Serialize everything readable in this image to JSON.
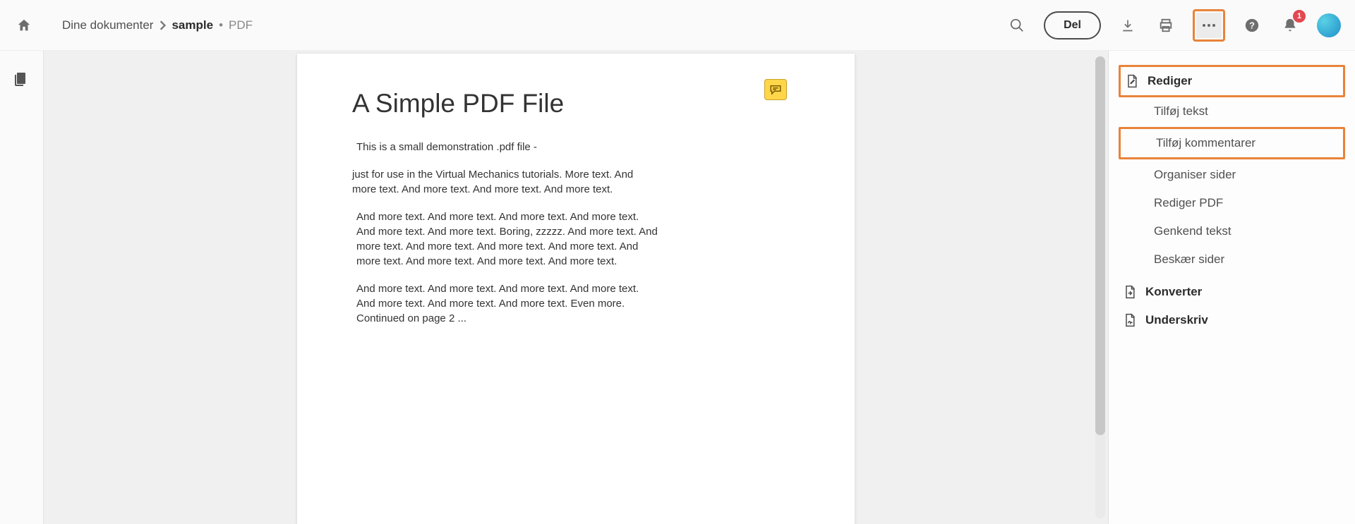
{
  "breadcrumb": {
    "root": "Dine dokumenter",
    "current": "sample",
    "file_type": "PDF"
  },
  "toolbar": {
    "share_label": "Del"
  },
  "notifications": {
    "badge_count": "1"
  },
  "document": {
    "title": "A Simple PDF File",
    "p1": "This is a small demonstration .pdf file -",
    "p2": "just for use in the Virtual Mechanics tutorials. More text. And more text. And more text. And more text. And more text.",
    "p3": "And more text. And more text. And more text. And more text. And more text. And more text. Boring, zzzzz. And more text. And more text. And more text. And more text. And more text. And more text. And more text. And more text. And more text.",
    "p4": "And more text. And more text. And more text. And more text. And more text. And more text. And more text. Even more. Continued on page 2 ..."
  },
  "sidebar": {
    "edit_header": "Rediger",
    "edit_items": {
      "add_text": "Tilføj tekst",
      "add_comments": "Tilføj kommentarer",
      "organize_pages": "Organiser sider",
      "edit_pdf": "Rediger PDF",
      "recognize_text": "Genkend tekst",
      "crop_pages": "Beskær sider"
    },
    "convert_header": "Konverter",
    "sign_header": "Underskriv"
  }
}
